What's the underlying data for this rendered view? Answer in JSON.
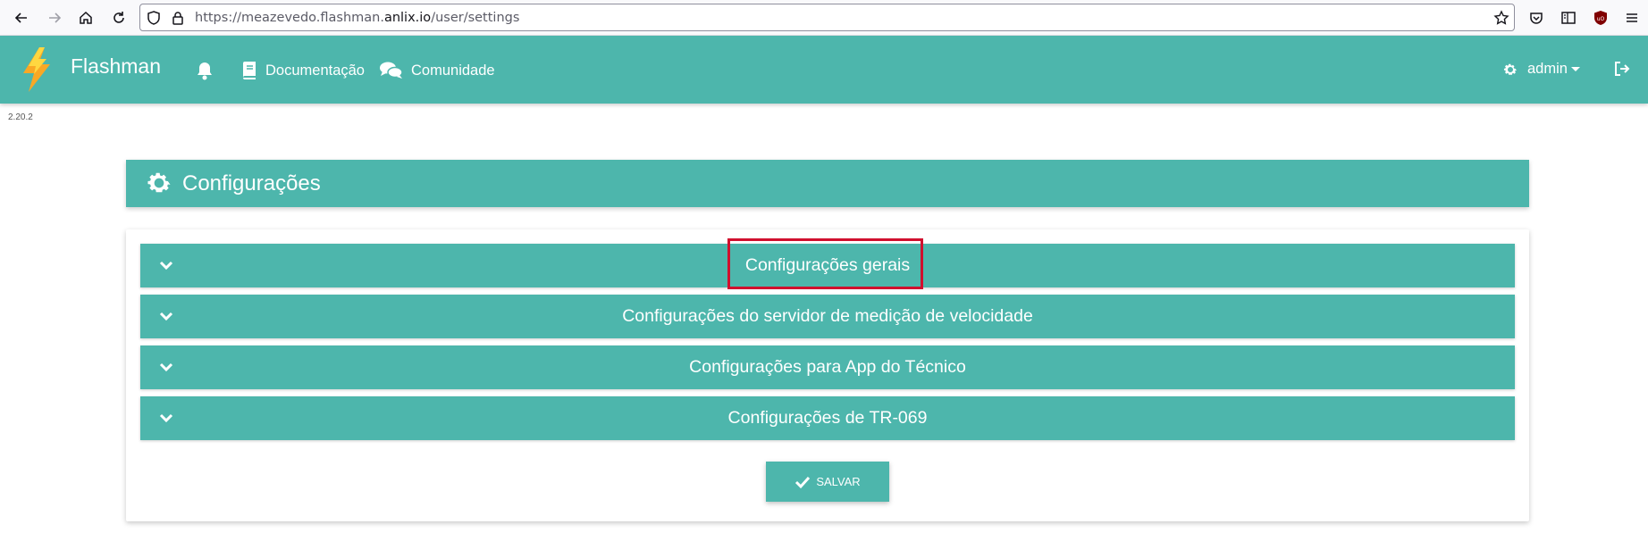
{
  "browser": {
    "url_prefix": "https://meazevedo.flashman.",
    "url_domain": "anlix.io",
    "url_path": "/user/settings"
  },
  "navbar": {
    "brand": "Flashman",
    "docs_label": "Documentação",
    "community_label": "Comunidade",
    "user_label": "admin"
  },
  "version": "2.20.2",
  "page": {
    "title": "Configurações"
  },
  "panels": [
    {
      "label": "Configurações gerais"
    },
    {
      "label": "Configurações do servidor de medição de velocidade"
    },
    {
      "label": "Configurações para App do Técnico"
    },
    {
      "label": "Configurações de TR-069"
    }
  ],
  "save_label": "SALVAR",
  "colors": {
    "primary": "#4db6ac",
    "highlight": "#d0102e"
  }
}
